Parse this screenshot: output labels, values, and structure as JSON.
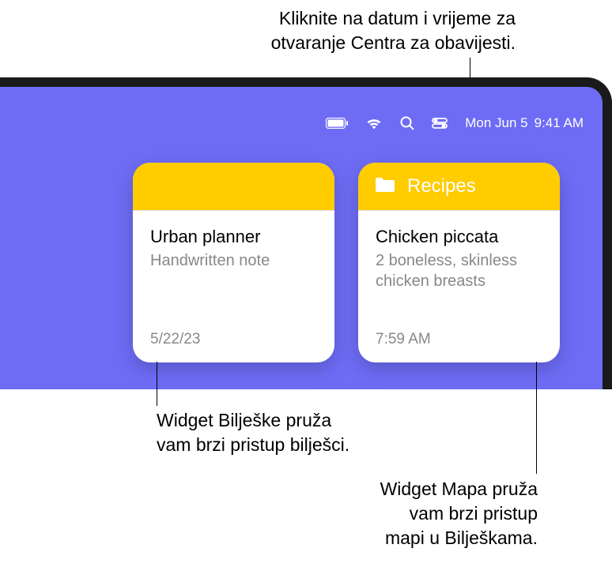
{
  "callouts": {
    "top_line1": "Kliknite na datum i vrijeme za",
    "top_line2": "otvaranje Centra za obavijesti.",
    "left_line1": "Widget Bilješke pruža",
    "left_line2": "vam brzi pristup bilješci.",
    "right_line1": "Widget Mapa pruža",
    "right_line2": "vam brzi pristup",
    "right_line3": "mapi u Bilješkama."
  },
  "menubar": {
    "date": "Mon Jun 5",
    "time": "9:41 AM"
  },
  "widgets": {
    "note": {
      "title": "Urban planner",
      "subtitle": "Handwritten note",
      "date": "5/22/23"
    },
    "folder": {
      "folder_name": "Recipes",
      "title": "Chicken piccata",
      "subtitle": "2 boneless, skinless chicken breasts",
      "time": "7:59 AM"
    }
  }
}
